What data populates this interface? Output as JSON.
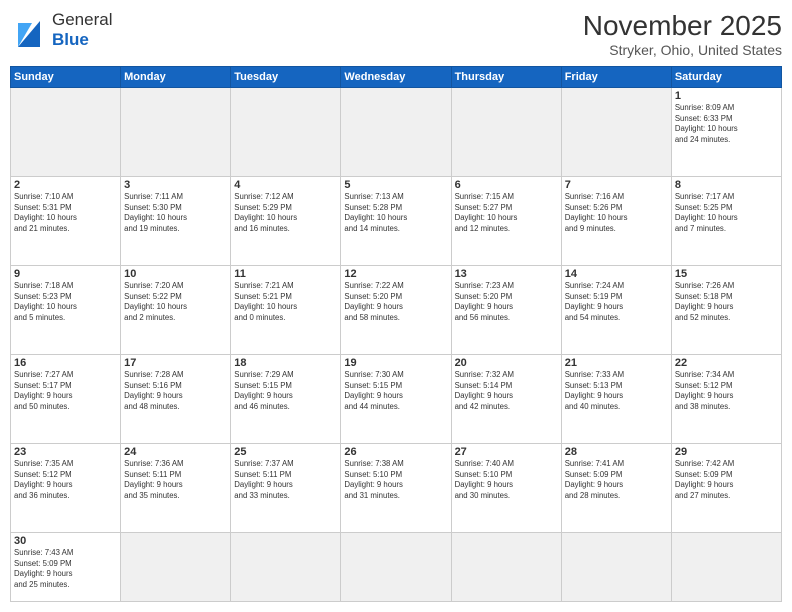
{
  "header": {
    "logo_line1": "General",
    "logo_line2": "Blue",
    "month_title": "November 2025",
    "subtitle": "Stryker, Ohio, United States"
  },
  "weekdays": [
    "Sunday",
    "Monday",
    "Tuesday",
    "Wednesday",
    "Thursday",
    "Friday",
    "Saturday"
  ],
  "weeks": [
    [
      {
        "day": "",
        "info": "",
        "empty": true
      },
      {
        "day": "",
        "info": "",
        "empty": true
      },
      {
        "day": "",
        "info": "",
        "empty": true
      },
      {
        "day": "",
        "info": "",
        "empty": true
      },
      {
        "day": "",
        "info": "",
        "empty": true
      },
      {
        "day": "",
        "info": "",
        "empty": true
      },
      {
        "day": "1",
        "info": "Sunrise: 8:09 AM\nSunset: 6:33 PM\nDaylight: 10 hours\nand 24 minutes."
      }
    ],
    [
      {
        "day": "2",
        "info": "Sunrise: 7:10 AM\nSunset: 5:31 PM\nDaylight: 10 hours\nand 21 minutes."
      },
      {
        "day": "3",
        "info": "Sunrise: 7:11 AM\nSunset: 5:30 PM\nDaylight: 10 hours\nand 19 minutes."
      },
      {
        "day": "4",
        "info": "Sunrise: 7:12 AM\nSunset: 5:29 PM\nDaylight: 10 hours\nand 16 minutes."
      },
      {
        "day": "5",
        "info": "Sunrise: 7:13 AM\nSunset: 5:28 PM\nDaylight: 10 hours\nand 14 minutes."
      },
      {
        "day": "6",
        "info": "Sunrise: 7:15 AM\nSunset: 5:27 PM\nDaylight: 10 hours\nand 12 minutes."
      },
      {
        "day": "7",
        "info": "Sunrise: 7:16 AM\nSunset: 5:26 PM\nDaylight: 10 hours\nand 9 minutes."
      },
      {
        "day": "8",
        "info": "Sunrise: 7:17 AM\nSunset: 5:25 PM\nDaylight: 10 hours\nand 7 minutes."
      }
    ],
    [
      {
        "day": "9",
        "info": "Sunrise: 7:18 AM\nSunset: 5:23 PM\nDaylight: 10 hours\nand 5 minutes."
      },
      {
        "day": "10",
        "info": "Sunrise: 7:20 AM\nSunset: 5:22 PM\nDaylight: 10 hours\nand 2 minutes."
      },
      {
        "day": "11",
        "info": "Sunrise: 7:21 AM\nSunset: 5:21 PM\nDaylight: 10 hours\nand 0 minutes."
      },
      {
        "day": "12",
        "info": "Sunrise: 7:22 AM\nSunset: 5:20 PM\nDaylight: 9 hours\nand 58 minutes."
      },
      {
        "day": "13",
        "info": "Sunrise: 7:23 AM\nSunset: 5:20 PM\nDaylight: 9 hours\nand 56 minutes."
      },
      {
        "day": "14",
        "info": "Sunrise: 7:24 AM\nSunset: 5:19 PM\nDaylight: 9 hours\nand 54 minutes."
      },
      {
        "day": "15",
        "info": "Sunrise: 7:26 AM\nSunset: 5:18 PM\nDaylight: 9 hours\nand 52 minutes."
      }
    ],
    [
      {
        "day": "16",
        "info": "Sunrise: 7:27 AM\nSunset: 5:17 PM\nDaylight: 9 hours\nand 50 minutes."
      },
      {
        "day": "17",
        "info": "Sunrise: 7:28 AM\nSunset: 5:16 PM\nDaylight: 9 hours\nand 48 minutes."
      },
      {
        "day": "18",
        "info": "Sunrise: 7:29 AM\nSunset: 5:15 PM\nDaylight: 9 hours\nand 46 minutes."
      },
      {
        "day": "19",
        "info": "Sunrise: 7:30 AM\nSunset: 5:15 PM\nDaylight: 9 hours\nand 44 minutes."
      },
      {
        "day": "20",
        "info": "Sunrise: 7:32 AM\nSunset: 5:14 PM\nDaylight: 9 hours\nand 42 minutes."
      },
      {
        "day": "21",
        "info": "Sunrise: 7:33 AM\nSunset: 5:13 PM\nDaylight: 9 hours\nand 40 minutes."
      },
      {
        "day": "22",
        "info": "Sunrise: 7:34 AM\nSunset: 5:12 PM\nDaylight: 9 hours\nand 38 minutes."
      }
    ],
    [
      {
        "day": "23",
        "info": "Sunrise: 7:35 AM\nSunset: 5:12 PM\nDaylight: 9 hours\nand 36 minutes."
      },
      {
        "day": "24",
        "info": "Sunrise: 7:36 AM\nSunset: 5:11 PM\nDaylight: 9 hours\nand 35 minutes."
      },
      {
        "day": "25",
        "info": "Sunrise: 7:37 AM\nSunset: 5:11 PM\nDaylight: 9 hours\nand 33 minutes."
      },
      {
        "day": "26",
        "info": "Sunrise: 7:38 AM\nSunset: 5:10 PM\nDaylight: 9 hours\nand 31 minutes."
      },
      {
        "day": "27",
        "info": "Sunrise: 7:40 AM\nSunset: 5:10 PM\nDaylight: 9 hours\nand 30 minutes."
      },
      {
        "day": "28",
        "info": "Sunrise: 7:41 AM\nSunset: 5:09 PM\nDaylight: 9 hours\nand 28 minutes."
      },
      {
        "day": "29",
        "info": "Sunrise: 7:42 AM\nSunset: 5:09 PM\nDaylight: 9 hours\nand 27 minutes."
      }
    ],
    [
      {
        "day": "30",
        "info": "Sunrise: 7:43 AM\nSunset: 5:09 PM\nDaylight: 9 hours\nand 25 minutes."
      },
      {
        "day": "",
        "info": "",
        "empty": true
      },
      {
        "day": "",
        "info": "",
        "empty": true
      },
      {
        "day": "",
        "info": "",
        "empty": true
      },
      {
        "day": "",
        "info": "",
        "empty": true
      },
      {
        "day": "",
        "info": "",
        "empty": true
      },
      {
        "day": "",
        "info": "",
        "empty": true
      }
    ]
  ]
}
